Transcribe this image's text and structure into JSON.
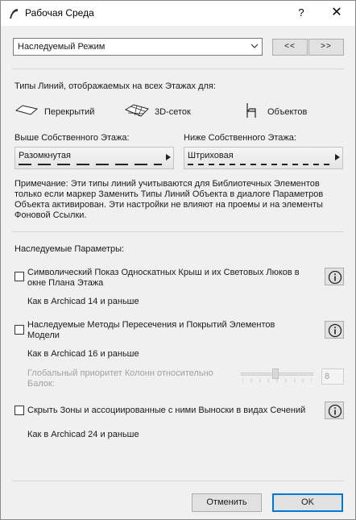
{
  "window": {
    "title": "Рабочая Среда",
    "help_label": "?",
    "close_label": "✕"
  },
  "mode": {
    "selected": "Наследуемый Режим",
    "prev_label": "<<",
    "next_label": ">>"
  },
  "line_types": {
    "heading": "Типы Линий, отображаемых на всех Этажах для:",
    "options": [
      {
        "label": "Перекрытий",
        "icon": "slab-icon"
      },
      {
        "label": "3D-сеток",
        "icon": "mesh-icon"
      },
      {
        "label": "Объектов",
        "icon": "chair-icon"
      }
    ],
    "above_label": "Выше Собственного Этажа:",
    "below_label": "Ниже Собственного Этажа:",
    "above_value": "Разомкнутая",
    "below_value": "Штриховая",
    "note": "Примечание: Эти типы линий учитываются для Библиотечных Элементов только если маркер Заменить Типы Линий Объекта в диалоге Параметров Объекта активирован. Эти настройки не влияют на проемы и на элементы Фоновой Ссылки."
  },
  "inherited": {
    "heading": "Наследуемые Параметры:",
    "items": [
      {
        "label": "Символический Показ Односкатных Крыш и их Световых Люков в окне Плана Этажа",
        "sub": "Как в Archicad 14 и раньше",
        "checked": false
      },
      {
        "label": "Наследуемые Методы Пересечения и Покрытий Элементов Модели",
        "sub": "Как в Archicad 16 и раньше",
        "checked": false
      },
      {
        "label": "Скрыть Зоны и ассоциированные с ними Выноски в видах Сечений",
        "sub": "Как в Archicad 24 и раньше",
        "checked": false
      }
    ],
    "column_priority_label": "Глобальный приоритет Колонн относительно Балок:",
    "column_priority_value": "8",
    "column_priority_level": 8
  },
  "footer": {
    "cancel_label": "Отменить",
    "ok_label": "OK"
  },
  "colors": {
    "accent": "#0078d7",
    "background": "#f0f0f0"
  }
}
